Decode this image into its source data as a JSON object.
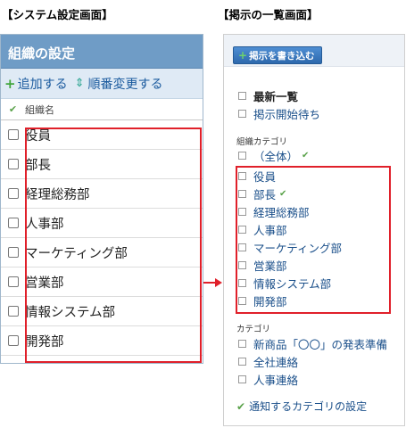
{
  "captions": {
    "left": "【システム設定画面】",
    "right": "【掲示の一覧画面】"
  },
  "left_panel": {
    "title": "組織の設定",
    "toolbar": {
      "add_label": "追加する",
      "reorder_label": "順番変更する"
    },
    "column_header": "組織名",
    "rows": [
      "役員",
      "部長",
      "経理総務部",
      "人事部",
      "マーケティング部",
      "営業部",
      "情報システム部",
      "開発部"
    ]
  },
  "right_panel": {
    "post_button_label": "掲示を書き込む",
    "top_items": [
      "最新一覧",
      "掲示開始待ち"
    ],
    "org_category_label": "組織カテゴリ",
    "all_label": "（全体）",
    "org_items": [
      "役員",
      "部長",
      "経理総務部",
      "人事部",
      "マーケティング部",
      "営業部",
      "情報システム部",
      "開発部"
    ],
    "category_label": "カテゴリ",
    "category_items": [
      "新商品「〇〇」の発表準備",
      "全社連絡",
      "人事連絡"
    ],
    "footer_link": "通知するカテゴリの設定"
  },
  "colors": {
    "header_blue": "#6f9cc6",
    "toolbar_bg": "#dfeaf5",
    "link_blue": "#1a4f8a",
    "highlight_red": "#e0202a",
    "check_green": "#5aa24a"
  }
}
